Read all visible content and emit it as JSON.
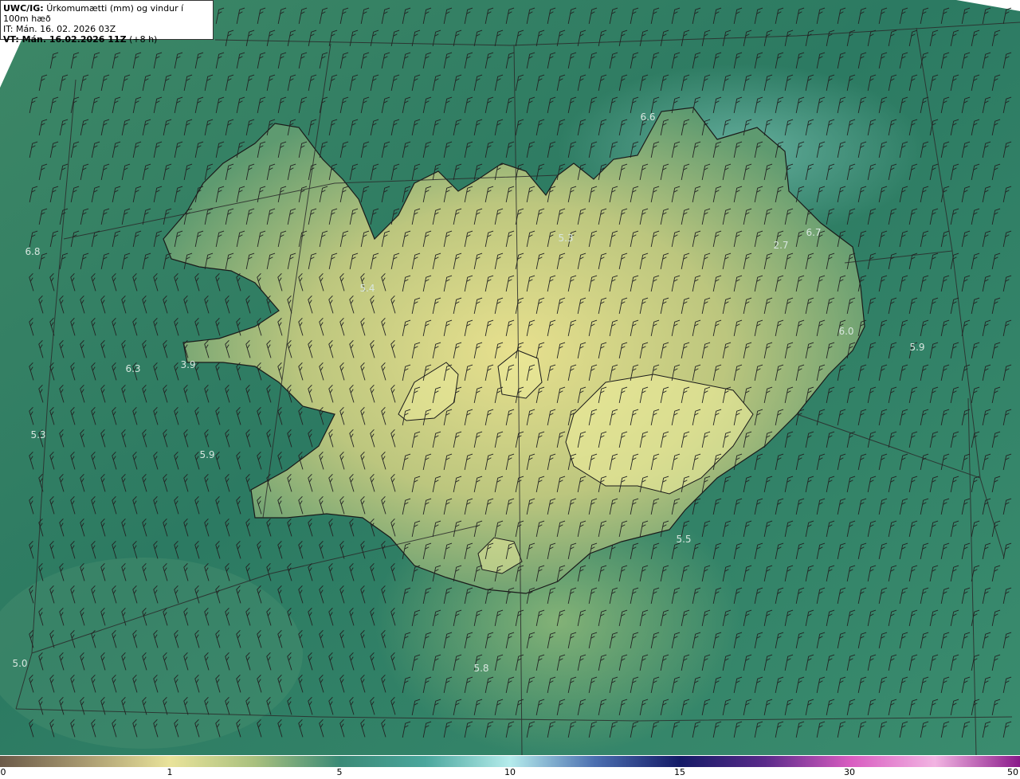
{
  "header": {
    "title_bold": "UWC/IG:",
    "title_rest": "Úrkomumætti (mm) og vindur í 100m hæð",
    "it_line": "IT: Mán. 16. 02. 2026 03Z",
    "vt_bold": "VT: Mán. 16.02.2026 11Z",
    "vt_rest": "(+8 h)"
  },
  "map_labels": [
    {
      "id": "l1",
      "text": "6.6"
    },
    {
      "id": "l2",
      "text": "6.8"
    },
    {
      "id": "l3",
      "text": "5.4"
    },
    {
      "id": "l4",
      "text": "5.3"
    },
    {
      "id": "l5",
      "text": "6.7"
    },
    {
      "id": "l6",
      "text": "2.7"
    },
    {
      "id": "l7",
      "text": "6.0"
    },
    {
      "id": "l8",
      "text": "5.9"
    },
    {
      "id": "l9",
      "text": "6.3"
    },
    {
      "id": "l10",
      "text": "3.9"
    },
    {
      "id": "l11",
      "text": "5.3"
    },
    {
      "id": "l12",
      "text": "5.9"
    },
    {
      "id": "l13",
      "text": "5.5"
    },
    {
      "id": "l14",
      "text": "5.0"
    },
    {
      "id": "l15",
      "text": "5.8"
    }
  ],
  "colorbar": {
    "ticks": [
      "0",
      "1",
      "5",
      "10",
      "15",
      "30",
      "50"
    ],
    "colors": [
      "#6b5a48",
      "#a99a70",
      "#e9e39a",
      "#a9c07e",
      "#3a8a76",
      "#4aa69c",
      "#b5ecec",
      "#4b6fb0",
      "#141a66",
      "#5a2a8a",
      "#d85cc0",
      "#f2b4e2",
      "#8a1a8a"
    ]
  },
  "map_style": {
    "sea_color": "#2f7a64",
    "land_color": "#cfcf80",
    "coast_color": "#1a1a1a",
    "grid_color": "#2a2a2a",
    "barb_color": "#222222"
  }
}
